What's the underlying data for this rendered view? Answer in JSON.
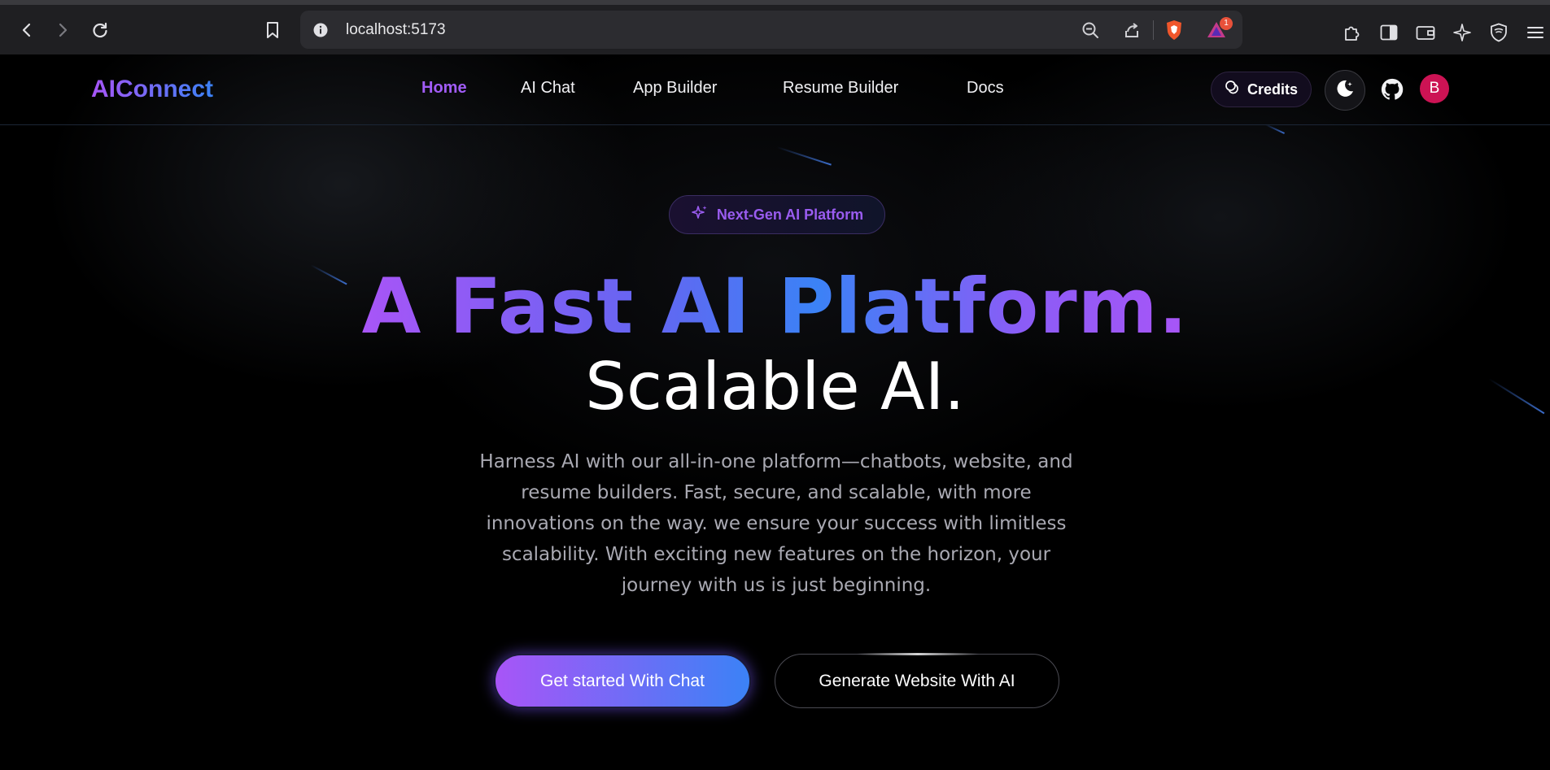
{
  "browser": {
    "url": "localhost:5173",
    "notification_count": "1"
  },
  "nav": {
    "logo": "AIConnect",
    "items": [
      {
        "label": "Home",
        "active": true
      },
      {
        "label": "AI Chat",
        "active": false
      },
      {
        "label": "App Builder",
        "active": false
      },
      {
        "label": "Resume Builder",
        "active": false
      },
      {
        "label": "Docs",
        "active": false
      }
    ],
    "credits_label": "Credits",
    "avatar_initial": "B"
  },
  "hero": {
    "badge": "Next-Gen AI Platform",
    "headline": "A Fast AI Platform.",
    "subheadline": "Scalable AI.",
    "description": "Harness AI with our all-in-one platform—chatbots, website, and resume builders. Fast, secure, and scalable, with more innovations on the way. we ensure your success with limitless scalability. With exciting new features on the horizon, your journey with us is just beginning.",
    "primary_cta": "Get started With Chat",
    "secondary_cta": "Generate Website With AI"
  },
  "colors": {
    "accent_purple": "#a855f7",
    "accent_blue": "#3b82f6",
    "avatar": "#cc1354"
  }
}
